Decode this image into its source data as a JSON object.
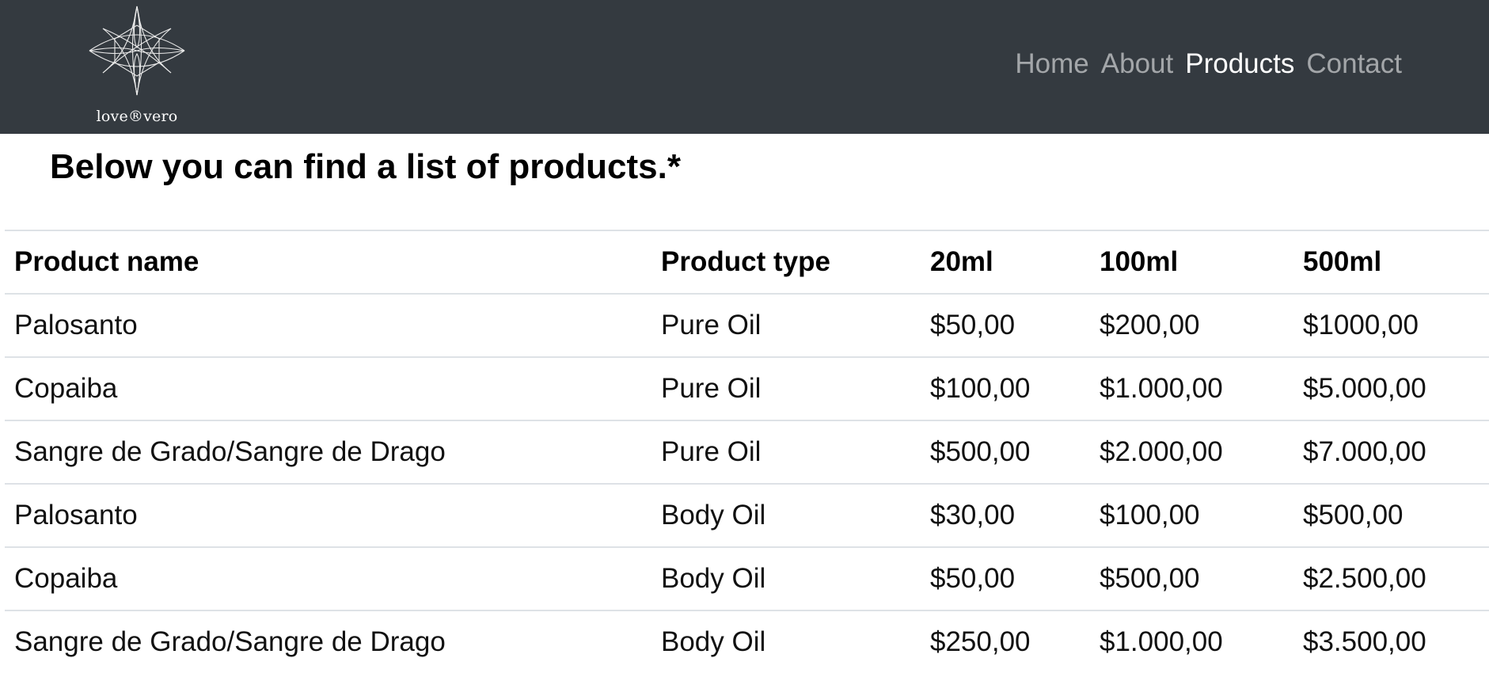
{
  "navbar": {
    "brand_text": "love®vero",
    "links": [
      {
        "label": "Home",
        "active": false
      },
      {
        "label": "About",
        "active": false
      },
      {
        "label": "Products",
        "active": true
      },
      {
        "label": "Contact",
        "active": false
      }
    ]
  },
  "page": {
    "heading": "Below you can find a list of products.*"
  },
  "table": {
    "headers": [
      "Product name",
      "Product type",
      "20ml",
      "100ml",
      "500ml"
    ],
    "rows": [
      [
        "Palosanto",
        "Pure Oil",
        "$50,00",
        "$200,00",
        "$1000,00"
      ],
      [
        "Copaiba",
        "Pure Oil",
        "$100,00",
        "$1.000,00",
        "$5.000,00"
      ],
      [
        "Sangre de Grado/Sangre de Drago",
        "Pure Oil",
        "$500,00",
        "$2.000,00",
        "$7.000,00"
      ],
      [
        "Palosanto",
        "Body Oil",
        "$30,00",
        "$100,00",
        "$500,00"
      ],
      [
        "Copaiba",
        "Body Oil",
        "$50,00",
        "$500,00",
        "$2.500,00"
      ],
      [
        "Sangre de Grado/Sangre de Drago",
        "Body Oil",
        "$250,00",
        "$1.000,00",
        "$3.500,00"
      ]
    ]
  },
  "colors": {
    "navbar_bg": "#343a40",
    "nav_link": "rgba(255,255,255,0.55)",
    "nav_link_active": "#ffffff",
    "table_border": "#dee2e6"
  },
  "icons": {
    "logo": "star-logo-icon"
  }
}
